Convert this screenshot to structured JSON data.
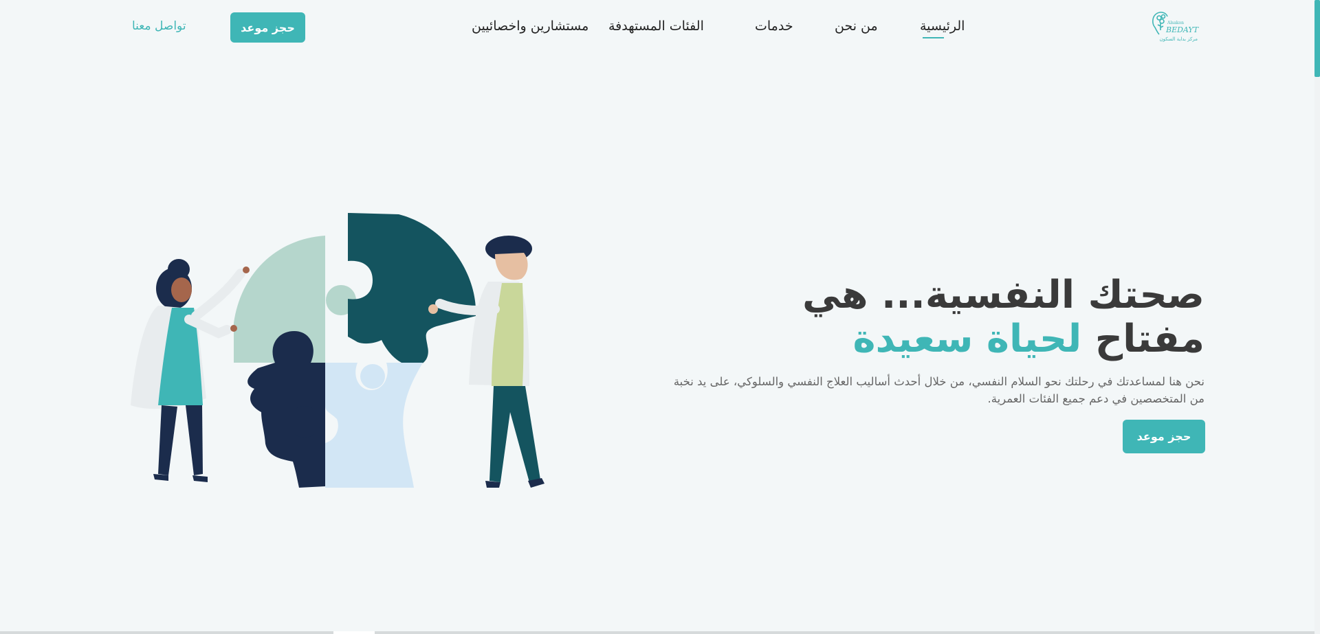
{
  "header": {
    "logo": {
      "brand_top": "Alsakon",
      "brand_main": "BEDAYT",
      "brand_ar": "مركز بداية السكون"
    },
    "nav": {
      "home": "الرئيسية",
      "about": "من نحن",
      "services": "خدمات",
      "target_groups": "الفئات المستهدفة",
      "consultants": "مستشارين واخصائيين"
    },
    "book_button": "حجز موعد",
    "contact_link": "تواصل معنا"
  },
  "hero": {
    "title_line1": "صحتك النفسية... هي",
    "title_line2_start": "مفتاح",
    "title_line2_accent": "لحياة سعيدة",
    "description": "نحن هنا لمساعدتك في رحلتك نحو السلام النفسي، من خلال أحدث أساليب العلاج النفسي والسلوكي، على يد نخبة من المتخصصين في دعم جميع الفئات العمرية.",
    "book_button": "حجز موعد"
  },
  "colors": {
    "accent": "#3fb6b6",
    "background": "#f3f7f8",
    "heading": "#3a3a3a",
    "puzzle_dark_teal": "#14545f",
    "puzzle_navy": "#1b2c4c",
    "puzzle_mint": "#b5d6cc",
    "puzzle_light_blue": "#d2e6f5"
  },
  "icons": {
    "logo": "head-tree-logo-icon",
    "illustration": "puzzle-head-people-illustration"
  }
}
